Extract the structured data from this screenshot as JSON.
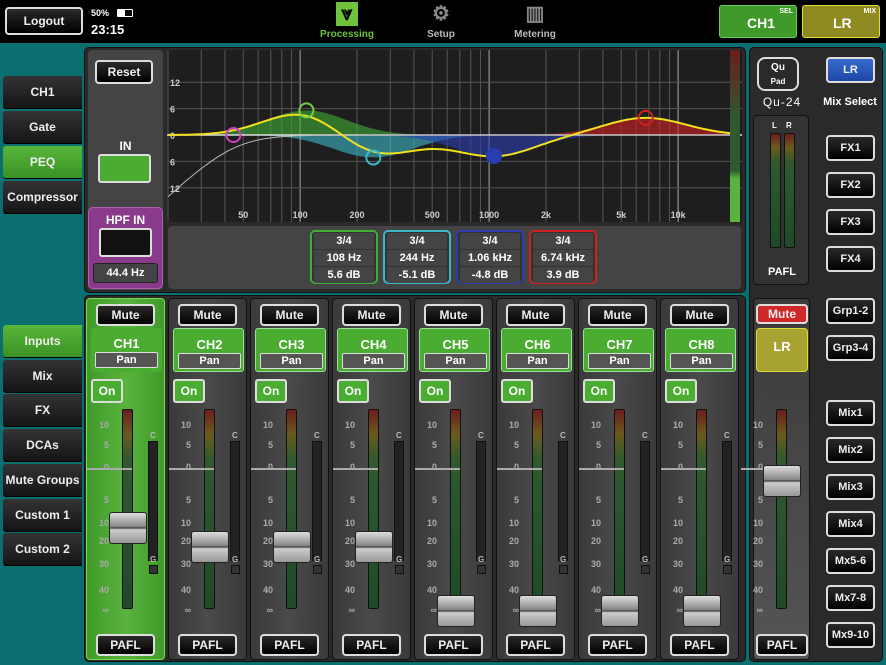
{
  "topbar": {
    "logout": "Logout",
    "battery": "50%",
    "time": "23:15",
    "nav": [
      {
        "label": "Processing",
        "icon": "processing-icon",
        "active": true
      },
      {
        "label": "Setup",
        "icon": "gears-icon",
        "active": false
      },
      {
        "label": "Metering",
        "icon": "meter-bars-icon",
        "active": false
      }
    ],
    "sel": {
      "label": "CH1",
      "tag": "SEL",
      "color": "#3f9a2a"
    },
    "mix": {
      "label": "LR",
      "tag": "MIX",
      "color": "#8f8a22"
    }
  },
  "proc_tabs": [
    {
      "label": "CH1",
      "active": false
    },
    {
      "label": "Gate",
      "active": false
    },
    {
      "label": "PEQ",
      "active": true
    },
    {
      "label": "Compressor",
      "active": false
    }
  ],
  "layer_tabs": [
    {
      "label": "Inputs",
      "active": true
    },
    {
      "label": "Mix"
    },
    {
      "label": "FX"
    },
    {
      "label": "DCAs"
    },
    {
      "label": "Mute Groups"
    },
    {
      "label": "Custom 1"
    },
    {
      "label": "Custom 2"
    }
  ],
  "peq": {
    "reset": "Reset",
    "in_label": "IN",
    "in_on": true,
    "hpf_label": "HPF IN",
    "hpf_on": false,
    "hpf_freq": "44.4 Hz",
    "hpf_hz": 44.4,
    "db_ticks": [
      "12",
      "6",
      "0",
      "6",
      "12"
    ],
    "freq_ticks": [
      {
        "hz": 50,
        "label": "50"
      },
      {
        "hz": 100,
        "label": "100"
      },
      {
        "hz": 200,
        "label": "200"
      },
      {
        "hz": 500,
        "label": "500"
      },
      {
        "hz": 1000,
        "label": "1000"
      },
      {
        "hz": 2000,
        "label": "2k"
      },
      {
        "hz": 5000,
        "label": "5k"
      },
      {
        "hz": 10000,
        "label": "10k"
      }
    ],
    "bands": [
      {
        "q": "3/4",
        "freq": "108 Hz",
        "gain": "5.6 dB",
        "hz": 108,
        "db": 5.6,
        "color": "#3fae35"
      },
      {
        "q": "3/4",
        "freq": "244 Hz",
        "gain": "-5.1 dB",
        "hz": 244,
        "db": -5.1,
        "color": "#3cb8c8"
      },
      {
        "q": "3/4",
        "freq": "1.06 kHz",
        "gain": "-4.8 dB",
        "hz": 1060,
        "db": -4.8,
        "color": "#2a3cb0"
      },
      {
        "q": "3/4",
        "freq": "6.74 kHz",
        "gain": "3.9 dB",
        "hz": 6740,
        "db": 3.9,
        "color": "#d02020"
      }
    ]
  },
  "fader_scale": [
    "10",
    "5",
    "0",
    "5",
    "10",
    "20",
    "30",
    "40",
    "∞"
  ],
  "strip_labels": {
    "mute": "Mute",
    "pan": "Pan",
    "on": "On",
    "pafl": "PAFL",
    "c": "C",
    "g": "G"
  },
  "channels": [
    {
      "name": "CH1",
      "fader_db": -12,
      "selected": true
    },
    {
      "name": "CH2",
      "fader_db": -22
    },
    {
      "name": "CH3",
      "fader_db": -22
    },
    {
      "name": "CH4",
      "fader_db": -22
    },
    {
      "name": "CH5",
      "fader_db": -60
    },
    {
      "name": "CH6",
      "fader_db": -60
    },
    {
      "name": "CH7",
      "fader_db": -60
    },
    {
      "name": "CH8",
      "fader_db": -60
    }
  ],
  "master": {
    "logo": "Qu Pad",
    "model": "Qu-24",
    "meter_l": "L",
    "meter_r": "R",
    "pafl": "PAFL",
    "mute": "Mute",
    "name": "LR",
    "fader_db": -2,
    "fader_pafl": "PAFL"
  },
  "mix_select": {
    "current": "LR",
    "label": "Mix Select",
    "buttons": [
      "FX1",
      "FX2",
      "FX3",
      "FX4",
      "Grp1-2",
      "Grp3-4",
      "Mix1",
      "Mix2",
      "Mix3",
      "Mix4",
      "Mx5-6",
      "Mx7-8",
      "Mx9-10"
    ]
  }
}
